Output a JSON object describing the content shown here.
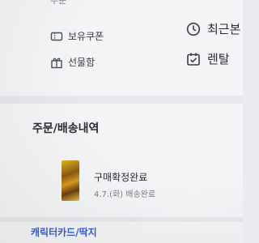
{
  "menu": {
    "cut_label": "주문",
    "coupon_label": "보유쿠폰",
    "gift_label": "선물함",
    "recent_label": "최근본",
    "rental_label": "렌탈"
  },
  "orders": {
    "title": "주문/배송내역",
    "status": "구매확정완료",
    "date_text": "4.7.(화) 배송완료"
  },
  "character": {
    "title": "캐릭터카드/딱지"
  },
  "colors": {
    "accent_blue": "#3b5fc8",
    "text_dark": "#2a2d33",
    "muted": "#7a7f87"
  }
}
